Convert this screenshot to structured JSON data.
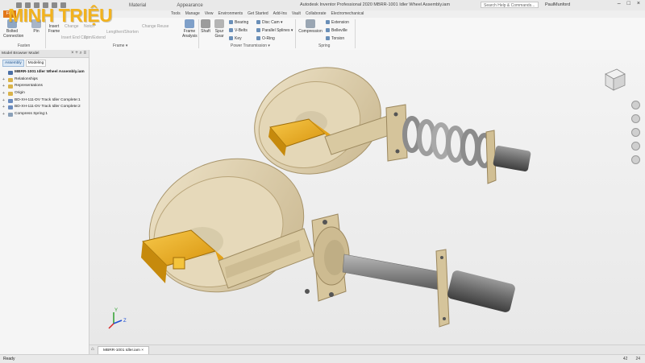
{
  "title_bar": {
    "window_title": "Autodesk Inventor Professional 2020    MBRR-1001 Idler Wheel Assembly.iam",
    "search_placeholder": "Search Help & Commands...",
    "user_name": "PaulMunford",
    "material_label": "Material",
    "appearance_label": "Appearance"
  },
  "logo_text": "MINH TRIỆU",
  "ribbon_tabs": {
    "file": "File",
    "tabs": [
      "Tools",
      "Manage",
      "View",
      "Environments",
      "Get Started",
      "Add-Ins",
      "Vault",
      "Collaborate",
      "Electromechanical"
    ]
  },
  "ribbon": {
    "fasten": {
      "label": "Fasten",
      "bolted": "Bolted Connection",
      "pin": "Pin"
    },
    "frame": {
      "label": "Frame ▾",
      "insert": "Insert Frame",
      "change": "Change",
      "insert_end_cap": "Insert End Cap",
      "notch": "Notch",
      "trim_extend": "Trim/Extend",
      "lengthen_shorten": "Lengthen/Shorten",
      "change_reuse": "Change Reuse",
      "frame_analysis": "Frame Analysis"
    },
    "power_transmission": {
      "label": "Power Transmission ▾",
      "shaft": "Shaft",
      "spur_gear": "Spur Gear",
      "bearing": "Bearing",
      "v_belts": "V-Belts",
      "key": "Key",
      "disc_cam": "Disc Cam ▾",
      "parallel_splines": "Parallel Splines ▾",
      "o_ring": "O-Ring"
    },
    "spring": {
      "label": "Spring",
      "compression": "Compression",
      "extension": "Extension",
      "belleville": "Belleville",
      "torsion": "Torsion"
    }
  },
  "browser": {
    "header": "Model Browser   Model",
    "subtabs": [
      "Assembly",
      "Modeling"
    ],
    "tree": [
      {
        "label": "MBRR-1001 Idler Wheel Assembly.iam",
        "root": true,
        "pm": "",
        "color": "#4a6fa5"
      },
      {
        "label": "Relationships",
        "pm": "+",
        "color": "#d9b34a"
      },
      {
        "label": "Representations",
        "pm": "+",
        "color": "#d9b34a"
      },
      {
        "label": "Origin",
        "pm": "+",
        "color": "#d9b34a"
      },
      {
        "label": "BD-XH-111-DV Track Idler Complete:1",
        "pm": "+",
        "color": "#6b8cbf"
      },
      {
        "label": "BD-XH-111-DV Track Idler Complete:2",
        "pm": "+",
        "color": "#6b8cbf"
      },
      {
        "label": "Compress Spring:1",
        "pm": "+",
        "color": "#8aa0b8"
      }
    ]
  },
  "document_tab": "MBRR-1001 Idler.iam",
  "status": {
    "ready": "Ready",
    "count1": "42",
    "count2": "24"
  },
  "colors": {
    "accent": "#e2771a",
    "wheel": "#e0d2b1",
    "bracket": "#f0b228",
    "shaft": "#7d7d7d",
    "spring": "#a9a9a9"
  }
}
